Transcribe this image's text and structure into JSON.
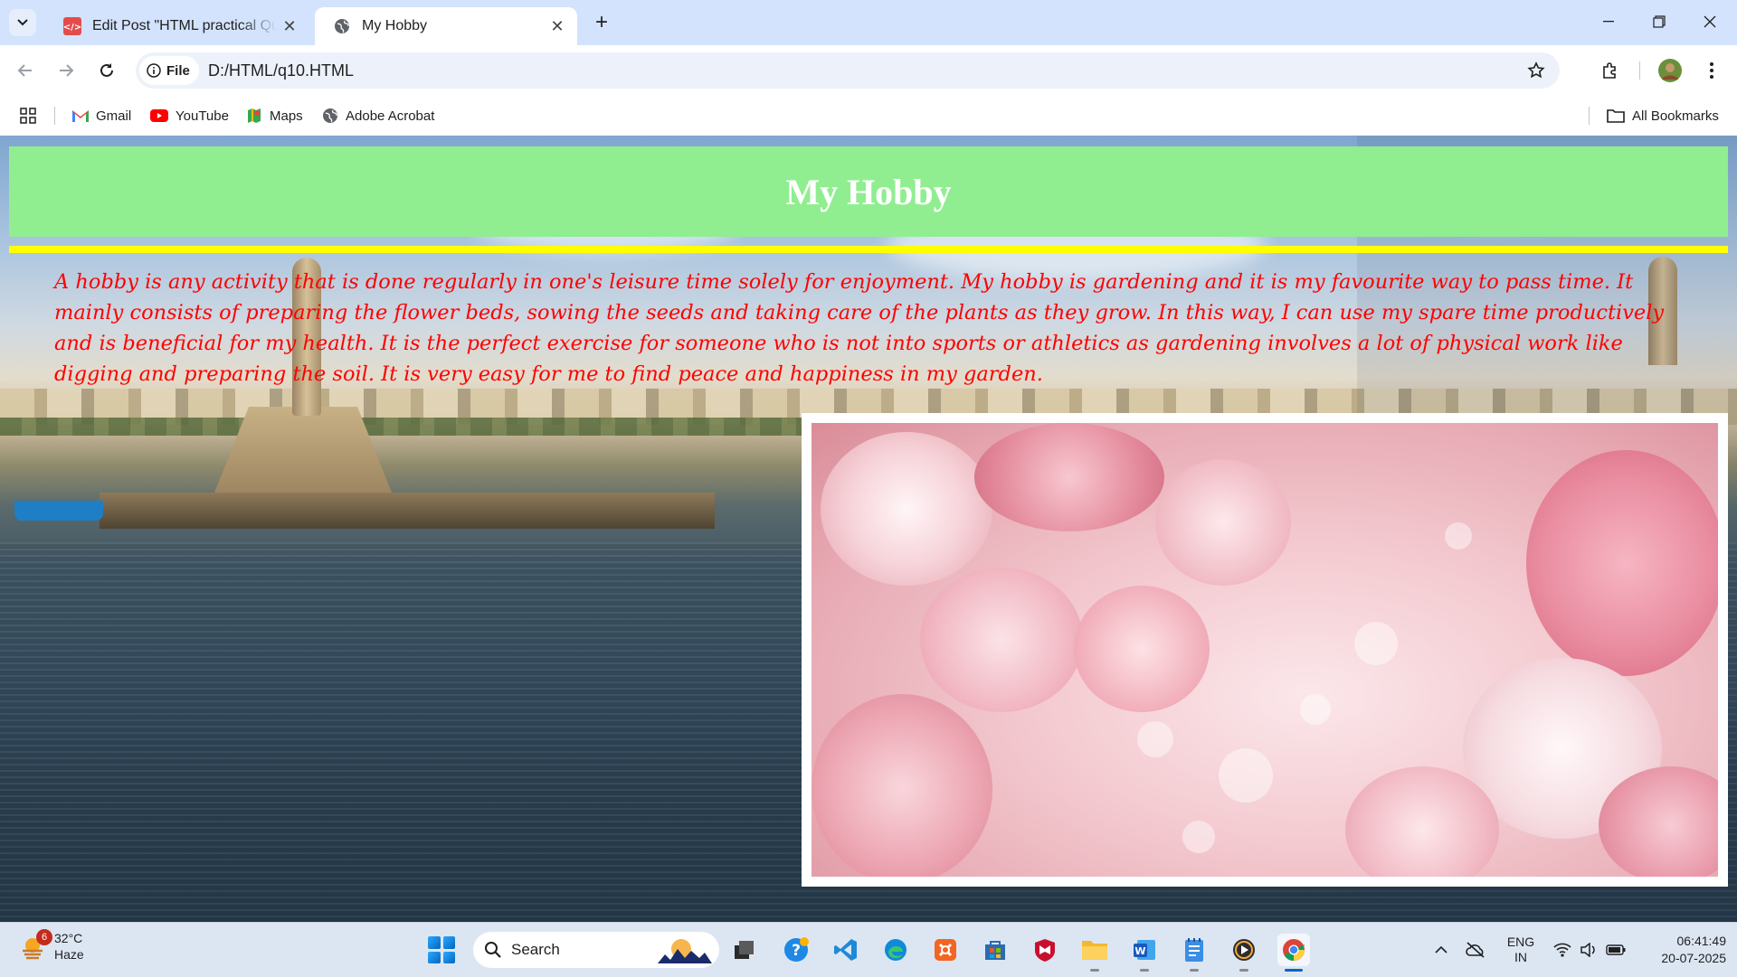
{
  "browser": {
    "tabs": [
      {
        "title": "Edit Post \"HTML practical Questions",
        "favicon": "code-favicon",
        "active": false
      },
      {
        "title": "My Hobby",
        "favicon": "globe-icon",
        "active": true
      }
    ],
    "omnibox": {
      "chip_label": "File",
      "url": "D:/HTML/q10.HTML"
    },
    "bookmarks": [
      {
        "label": "Gmail",
        "icon": "gmail-icon"
      },
      {
        "label": "YouTube",
        "icon": "youtube-icon"
      },
      {
        "label": "Maps",
        "icon": "maps-icon"
      },
      {
        "label": "Adobe Acrobat",
        "icon": "globe-icon"
      }
    ],
    "all_bookmarks_label": "All Bookmarks"
  },
  "page": {
    "heading": "My Hobby",
    "paragraph": "A hobby is any activity that is done regularly in one's leisure time solely for enjoyment. My hobby is gardening and it is my favourite way to pass time. It mainly consists of preparing the flower beds, sowing the seeds and taking care of the plants as they grow. In this way, I can use my spare time productively and is beneficial for my health. It is the perfect exercise for someone who is not into sports or athletics as gardening involves a lot of physical work like digging and preparing the soil. It is very easy for me to find peace and happiness in my garden.",
    "colors": {
      "header_bg": "#90ee90",
      "rule": "#ffff00",
      "text": "#ff0000"
    }
  },
  "taskbar": {
    "weather": {
      "temp": "32°C",
      "condition": "Haze",
      "badge": "6"
    },
    "search_placeholder": "Search",
    "language": {
      "line1": "ENG",
      "line2": "IN"
    },
    "clock": {
      "time": "06:41:49",
      "date": "20-07-2025"
    }
  }
}
